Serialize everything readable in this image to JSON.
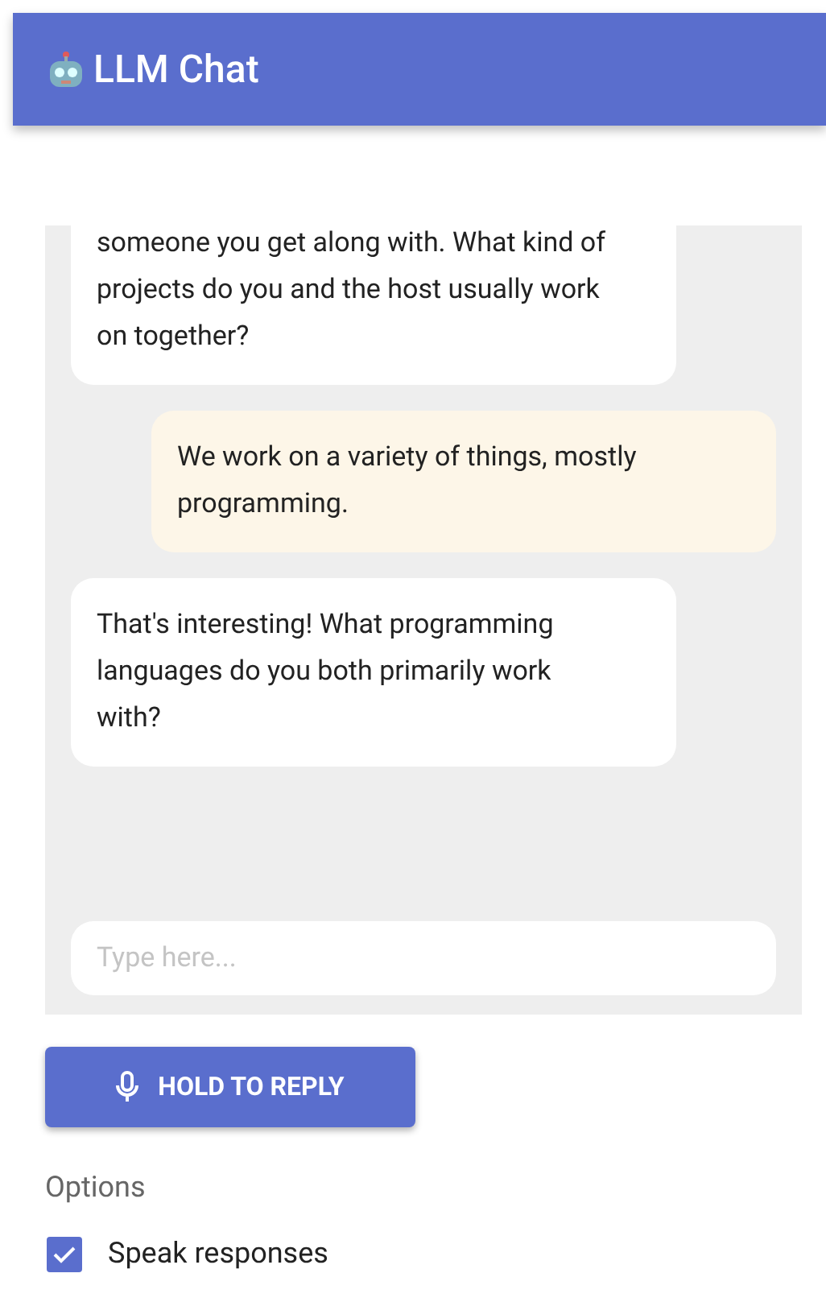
{
  "header": {
    "title": "LLM Chat"
  },
  "messages": [
    {
      "kind": "assistant",
      "text": "someone you get along with. What kind of projects do you and the host usually work on together?"
    },
    {
      "kind": "user",
      "text": "We work on a variety of things, mostly programming."
    },
    {
      "kind": "assistant",
      "text": "That's interesting! What programming languages do you both primarily work with?"
    }
  ],
  "input": {
    "placeholder": "Type here..."
  },
  "reply_button": {
    "label": "HOLD TO REPLY"
  },
  "options": {
    "heading": "Options",
    "items": [
      {
        "label": "Speak responses",
        "checked": true
      }
    ]
  }
}
